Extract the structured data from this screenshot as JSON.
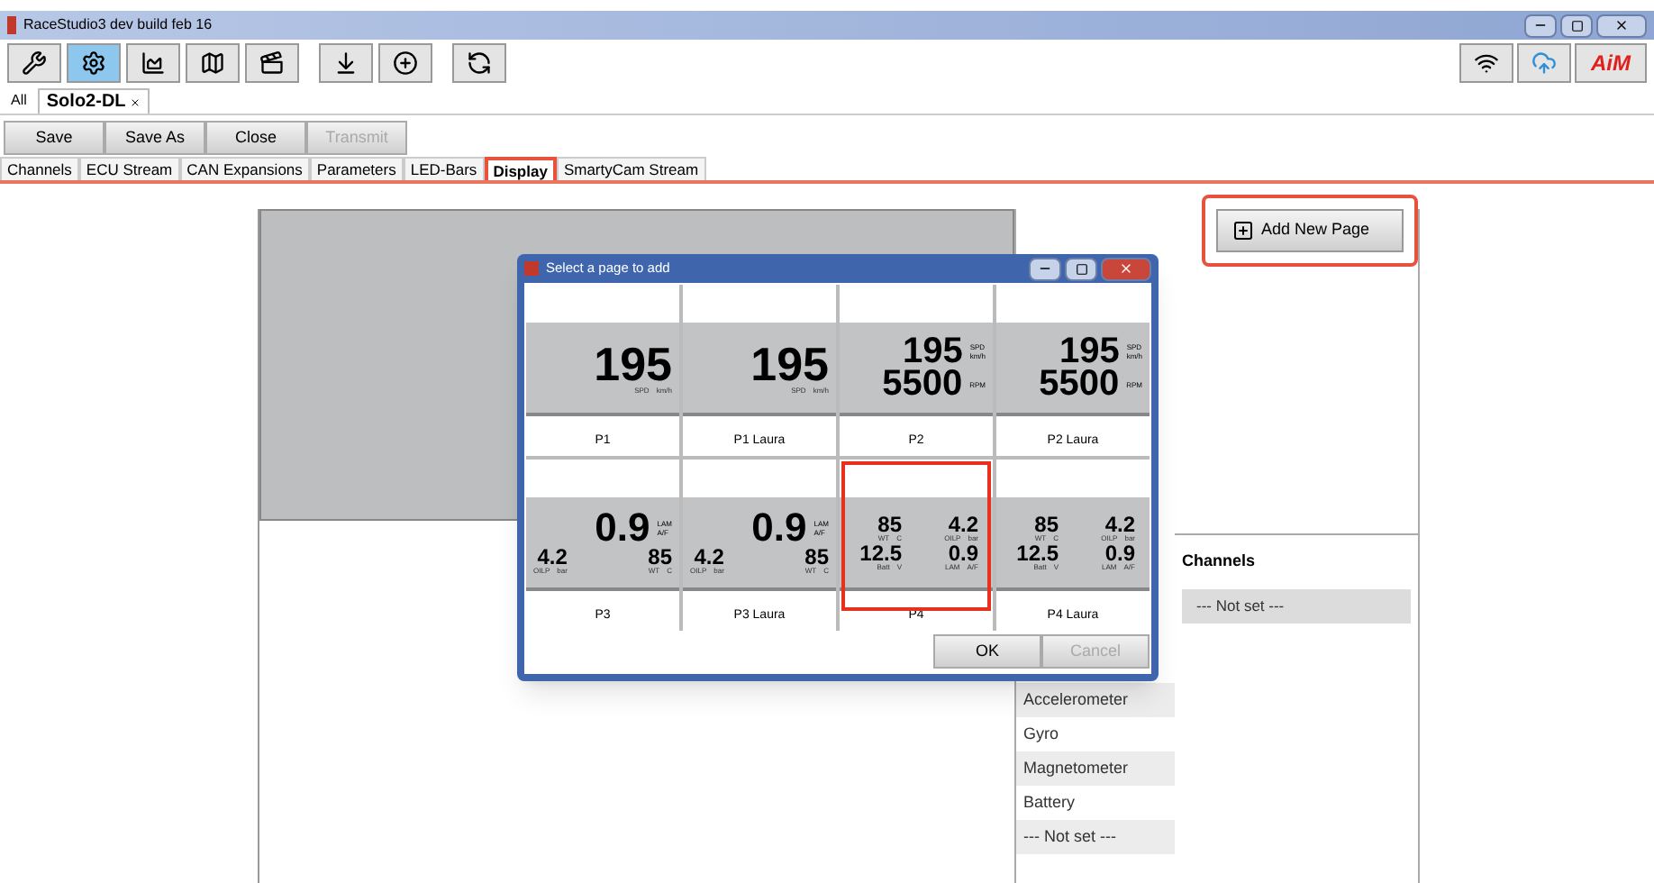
{
  "window": {
    "title": "RaceStudio3 dev  build feb 16"
  },
  "toolbar": {
    "tools": [
      {
        "kind": "wrench",
        "selected": false
      },
      {
        "kind": "gear",
        "selected": true
      },
      {
        "kind": "chart",
        "selected": false
      },
      {
        "kind": "track",
        "selected": false
      },
      {
        "kind": "clapper",
        "selected": false
      },
      {
        "kind": "level",
        "selected": false
      },
      {
        "kind": "add",
        "selected": false
      },
      {
        "kind": "sync",
        "selected": false
      }
    ],
    "logo": "AiM"
  },
  "device_tabs": [
    {
      "label": "All",
      "selected": false,
      "closable": false
    },
    {
      "label": "Solo2-DL",
      "selected": true,
      "closable": true
    }
  ],
  "actions": [
    {
      "label": "Save",
      "disabled": false
    },
    {
      "label": "Save As",
      "disabled": false
    },
    {
      "label": "Close",
      "disabled": false
    },
    {
      "label": "Transmit",
      "disabled": true
    }
  ],
  "tabs": [
    {
      "label": "Channels",
      "selected": false,
      "highlighted": false
    },
    {
      "label": "ECU Stream",
      "selected": false,
      "highlighted": false
    },
    {
      "label": "CAN Expansions",
      "selected": false,
      "highlighted": false
    },
    {
      "label": "Parameters",
      "selected": false,
      "highlighted": false
    },
    {
      "label": "LED-Bars",
      "selected": false,
      "highlighted": false
    },
    {
      "label": "Display",
      "selected": true,
      "highlighted": true
    },
    {
      "label": "SmartyCam Stream",
      "selected": false,
      "highlighted": false
    }
  ],
  "add_page_button": {
    "label": "Add New Page",
    "highlighted": true
  },
  "source_list": [
    {
      "label": "Accelerometer"
    },
    {
      "label": "Gyro"
    },
    {
      "label": "Magnetometer"
    },
    {
      "label": "Battery"
    },
    {
      "label": "--- Not set ---"
    }
  ],
  "channels": {
    "title": "Channels",
    "value": "--- Not set ---"
  },
  "dialog": {
    "title": "Select a page to add",
    "pages": [
      {
        "label": "P1",
        "kind": "single",
        "highlighted": false,
        "fields": [
          {
            "value": "195",
            "name": "SPD",
            "unit": "km/h"
          }
        ]
      },
      {
        "label": "P1 Laura",
        "kind": "single",
        "highlighted": false,
        "fields": [
          {
            "value": "195",
            "name": "SPD",
            "unit": "km/h"
          }
        ]
      },
      {
        "label": "P2",
        "kind": "double",
        "highlighted": false,
        "fields": [
          {
            "value": "195",
            "name": "SPD",
            "unit": "km/h"
          },
          {
            "value": "5500",
            "name": "RPM"
          }
        ]
      },
      {
        "label": "P2 Laura",
        "kind": "double",
        "highlighted": false,
        "fields": [
          {
            "value": "195",
            "name": "SPD",
            "unit": "km/h"
          },
          {
            "value": "5500",
            "name": "RPM"
          }
        ]
      },
      {
        "label": "P3",
        "kind": "big_top",
        "highlighted": false,
        "fields": [
          {
            "value": "0.9",
            "name": "LAM",
            "unit": "A/F"
          },
          {
            "value": "4.2",
            "name": "OILP",
            "unit": "bar"
          },
          {
            "value": "85",
            "name": "WT",
            "unit": "C"
          }
        ]
      },
      {
        "label": "P3 Laura",
        "kind": "big_top",
        "highlighted": false,
        "fields": [
          {
            "value": "0.9",
            "name": "LAM",
            "unit": "A/F"
          },
          {
            "value": "4.2",
            "name": "OILP",
            "unit": "bar"
          },
          {
            "value": "85",
            "name": "WT",
            "unit": "C"
          }
        ]
      },
      {
        "label": "P4",
        "kind": "quad",
        "highlighted": true,
        "fields": [
          {
            "value": "85",
            "name": "WT",
            "unit": "C"
          },
          {
            "value": "4.2",
            "name": "OILP",
            "unit": "bar"
          },
          {
            "value": "12.5",
            "name": "Batt",
            "unit": "V"
          },
          {
            "value": "0.9",
            "name": "LAM",
            "unit": "A/F"
          }
        ]
      },
      {
        "label": "P4 Laura",
        "kind": "quad",
        "highlighted": false,
        "fields": [
          {
            "value": "85",
            "name": "WT",
            "unit": "C"
          },
          {
            "value": "4.2",
            "name": "OILP",
            "unit": "bar"
          },
          {
            "value": "12.5",
            "name": "Batt",
            "unit": "V"
          },
          {
            "value": "0.9",
            "name": "LAM",
            "unit": "A/F"
          }
        ]
      }
    ],
    "buttons": [
      {
        "label": "OK",
        "disabled": false
      },
      {
        "label": "Cancel",
        "disabled": true
      }
    ]
  }
}
